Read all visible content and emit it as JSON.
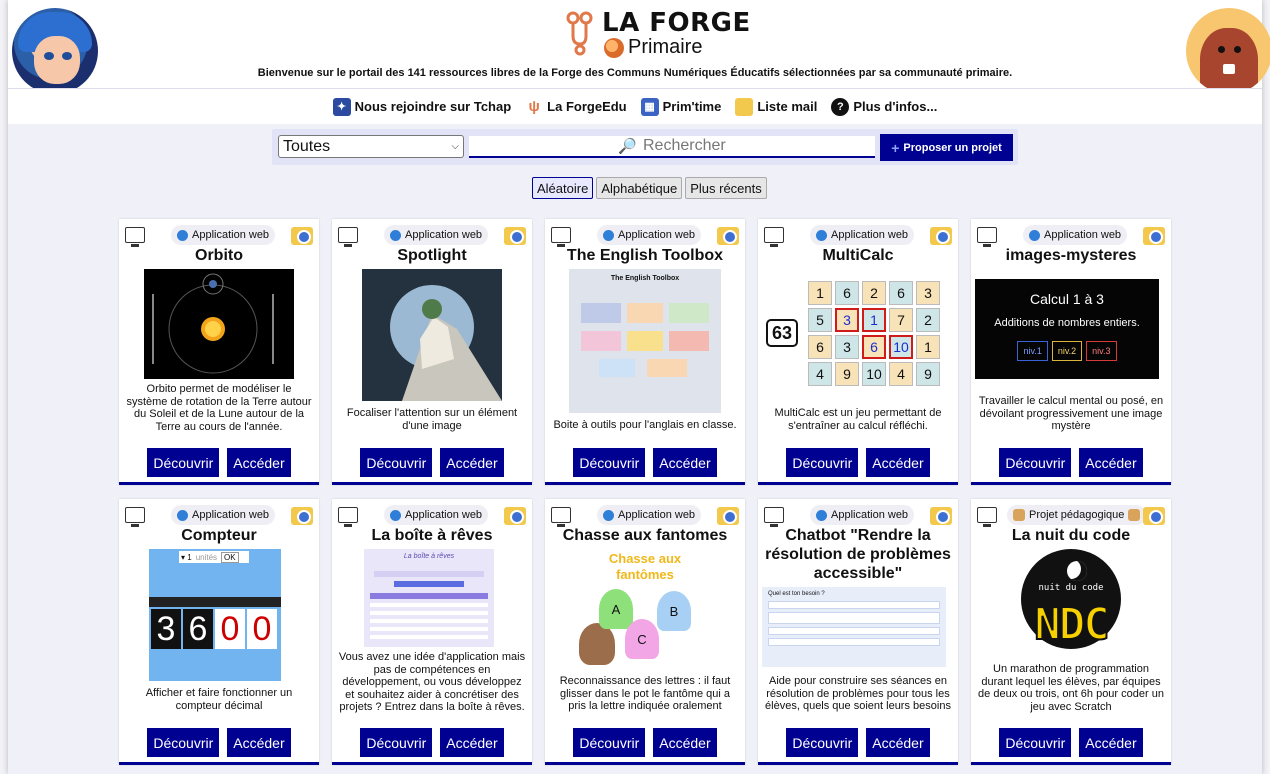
{
  "header": {
    "logo_title": "LA FORGE",
    "logo_subtitle": "Primaire",
    "welcome": "Bienvenue sur le portail des 141 ressources libres de la Forge des Communs Numériques Éducatifs sélectionnées par sa communauté primaire."
  },
  "nav": {
    "tchap": "Nous rejoindre sur Tchap",
    "forgeedu": "La ForgeEdu",
    "primtime": "Prim'time",
    "mailing": "Liste mail",
    "info": "Plus d'infos..."
  },
  "filter": {
    "select_value": "Toutes",
    "search_placeholder": "Rechercher",
    "propose_label": "Proposer un projet"
  },
  "sort": {
    "random": "Aléatoire",
    "alpha": "Alphabétique",
    "recent": "Plus récents"
  },
  "buttons": {
    "discover": "Découvrir",
    "access": "Accéder"
  },
  "cards": [
    {
      "badge": "Application web",
      "title": "Orbito",
      "description": "Orbito permet de modéliser le système de rotation de la Terre autour du Soleil et de la Lune autour de la Terre au cours de l'année."
    },
    {
      "badge": "Application web",
      "title": "Spotlight",
      "description": "Focaliser l'attention sur un élément d'une image"
    },
    {
      "badge": "Application web",
      "title": "The English Toolbox",
      "description": "Boite à outils pour l'anglais en classe.",
      "thumb_text": "The English Toolbox"
    },
    {
      "badge": "Application web",
      "title": "MultiCalc",
      "description": "MultiCalc est un jeu permettant de s'entraîner au calcul réfléchi.",
      "target": "63"
    },
    {
      "badge": "Application web",
      "title": "images-mysteres",
      "description": "Travailler le calcul mental ou posé, en dévoilant progressivement une image mystère",
      "thumb_title": "Calcul 1 à 3",
      "thumb_subtitle": "Additions de nombres entiers.",
      "levels": [
        "niv.1",
        "niv.2",
        "niv.3"
      ]
    },
    {
      "badge": "Application web",
      "title": "Compteur",
      "description": "Afficher et faire fonctionner un compteur décimal",
      "digits": [
        "3",
        "6",
        "0",
        "0"
      ]
    },
    {
      "badge": "Application web",
      "title": "La boîte à rêves",
      "description": "Vous avez une idée d'application mais pas de compétences en développement, ou vous développez et souhaitez aider à concrétiser des projets ? Entrez dans la boîte à rêves.",
      "thumb_text": "La boîte à rêves"
    },
    {
      "badge": "Application web",
      "title": "Chasse aux fantomes",
      "description": "Reconnaissance des lettres : il faut glisser dans le pot le fantôme qui a pris la lettre indiquée oralement",
      "thumb_text": "Chasse aux fantômes",
      "letters": [
        "A",
        "B",
        "C"
      ]
    },
    {
      "badge": "Application web",
      "title": "Chatbot \"Rendre la résolution de problèmes accessible\"",
      "description": "Aide pour construire ses séances en résolution de problèmes pour tous les élèves, quels que soient leurs besoins",
      "thumb_text": "Quel est ton besoin ?"
    },
    {
      "badge": "Projet pédagogique",
      "title": "La nuit du code",
      "description": "Un marathon de programmation durant lequel les élèves, par équipes de deux ou trois, ont 6h pour coder un jeu avec Scratch",
      "thumb_text": "nuit du code",
      "thumb_logo": "NDC"
    }
  ],
  "multicalc_grid": [
    [
      "1",
      "6",
      "2",
      "6",
      "3"
    ],
    [
      "5",
      "3",
      "1",
      "7",
      "2"
    ],
    [
      "6",
      "3",
      "6",
      "10",
      "1"
    ],
    [
      "4",
      "9",
      "10",
      "4",
      "9"
    ]
  ],
  "colors": {
    "accent": "#000091",
    "background": "#f0f0f8"
  }
}
